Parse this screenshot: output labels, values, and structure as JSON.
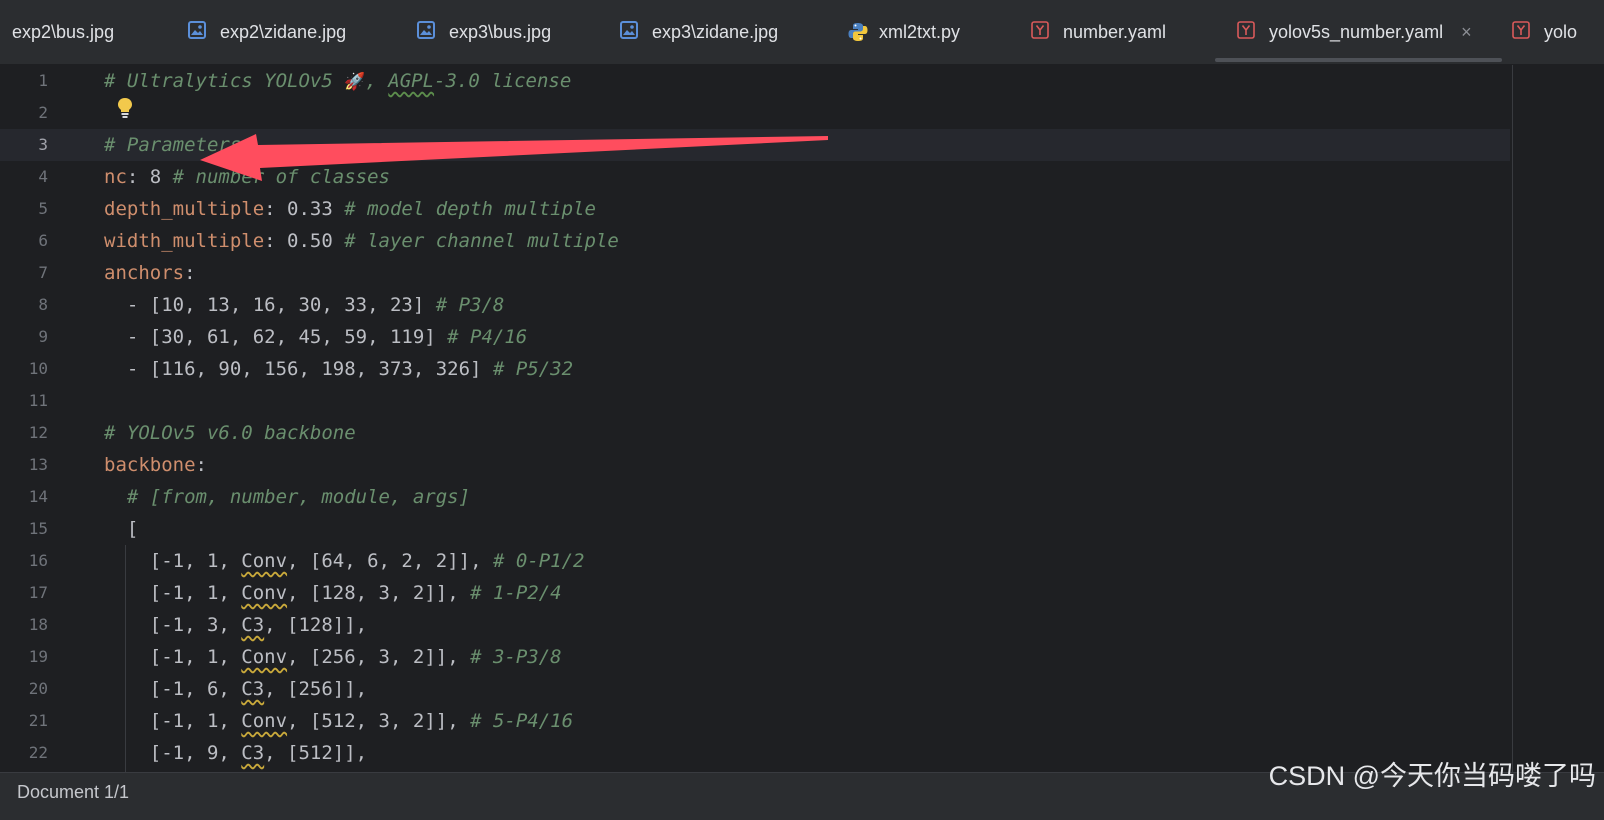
{
  "tabs": [
    {
      "label": "exp2\\bus.jpg",
      "icon": "none"
    },
    {
      "label": "exp2\\zidane.jpg",
      "icon": "image-icon"
    },
    {
      "label": "exp3\\bus.jpg",
      "icon": "image-icon"
    },
    {
      "label": "exp3\\zidane.jpg",
      "icon": "image-icon"
    },
    {
      "label": "xml2txt.py",
      "icon": "python-icon"
    },
    {
      "label": "number.yaml",
      "icon": "yaml-icon"
    },
    {
      "label": "yolov5s_number.yaml",
      "icon": "yaml-icon",
      "active": true,
      "close": "×"
    },
    {
      "label": "yolo",
      "icon": "yaml-icon"
    }
  ],
  "lines": [
    {
      "n": "1"
    },
    {
      "n": "2"
    },
    {
      "n": "3"
    },
    {
      "n": "4"
    },
    {
      "n": "5"
    },
    {
      "n": "6"
    },
    {
      "n": "7"
    },
    {
      "n": "8"
    },
    {
      "n": "9"
    },
    {
      "n": "10"
    },
    {
      "n": "11"
    },
    {
      "n": "12"
    },
    {
      "n": "13"
    },
    {
      "n": "14"
    },
    {
      "n": "15"
    },
    {
      "n": "16"
    },
    {
      "n": "17"
    },
    {
      "n": "18"
    },
    {
      "n": "19"
    },
    {
      "n": "20"
    },
    {
      "n": "21"
    },
    {
      "n": "22"
    }
  ],
  "code": {
    "l1": {
      "a": "# Ultralytics YOLOv5 ",
      "rocket": "🚀",
      "b": ", ",
      "c": "AGPL",
      "d": "-3.0 license"
    },
    "l3": "# Parameters",
    "l4": {
      "key": "nc",
      "rest": ": 8 ",
      "comment": "# number of classes"
    },
    "l5": {
      "key": "depth_multiple",
      "rest": ": 0.33 ",
      "comment": "# model depth multiple"
    },
    "l6": {
      "key": "width_multiple",
      "rest": ": 0.50 ",
      "comment": "# layer channel multiple"
    },
    "l7": {
      "key": "anchors",
      "rest": ":"
    },
    "l8": {
      "rest": "  - [10, 13, 16, 30, 33, 23] ",
      "comment": "# P3/8"
    },
    "l9": {
      "rest": "  - [30, 61, 62, 45, 59, 119] ",
      "comment": "# P4/16"
    },
    "l10": {
      "rest": "  - [116, 90, 156, 198, 373, 326] ",
      "comment": "# P5/32"
    },
    "l12": "# YOLOv5 v6.0 backbone",
    "l13": {
      "key": "backbone",
      "rest": ":"
    },
    "l14": "  # [from, number, module, args]",
    "l15": "  [",
    "l16": {
      "a": "    [-1, 1, ",
      "m": "Conv",
      "b": ", [64, 6, 2, 2]], ",
      "comment": "# 0-P1/2"
    },
    "l17": {
      "a": "    [-1, 1, ",
      "m": "Conv",
      "b": ", [128, 3, 2]], ",
      "comment": "# 1-P2/4"
    },
    "l18": {
      "a": "    [-1, 3, ",
      "m": "C3",
      "b": ", [128]],"
    },
    "l19": {
      "a": "    [-1, 1, ",
      "m": "Conv",
      "b": ", [256, 3, 2]], ",
      "comment": "# 3-P3/8"
    },
    "l20": {
      "a": "    [-1, 6, ",
      "m": "C3",
      "b": ", [256]],"
    },
    "l21": {
      "a": "    [-1, 1, ",
      "m": "Conv",
      "b": ", [512, 3, 2]], ",
      "comment": "# 5-P4/16"
    },
    "l22": {
      "a": "    [-1, 9, ",
      "m": "C3",
      "b": ", [512]],"
    }
  },
  "status": {
    "text": "Document 1/1"
  },
  "watermark": "CSDN @今天你当码喽了吗",
  "colors": {
    "comment": "#6a8f6e",
    "key": "#cf8e6d",
    "arrow": "#ff4d5e",
    "background": "#1e1f22"
  }
}
